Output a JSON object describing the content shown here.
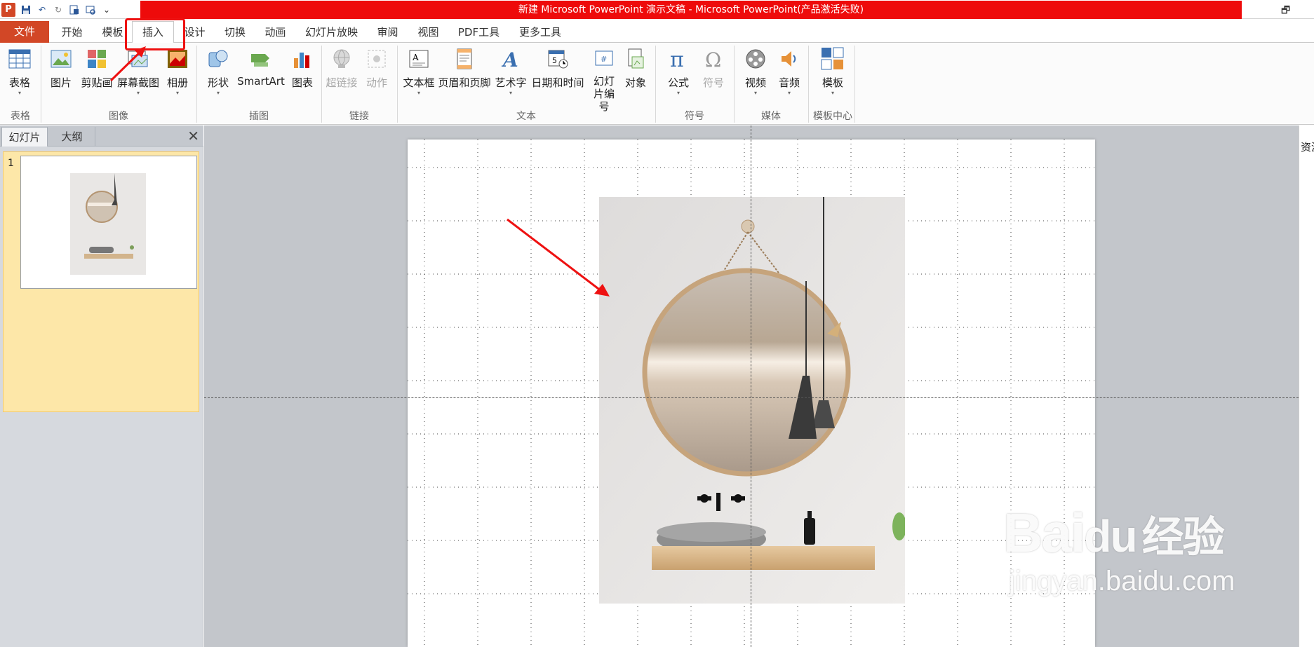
{
  "window": {
    "title": "新建 Microsoft PowerPoint 演示文稿 - Microsoft PowerPoint(产品激活失败)",
    "app_icon_letter": "P",
    "restore_glyph": "🗗"
  },
  "quick_access": {
    "icons": [
      "save-icon",
      "undo-icon",
      "redo-icon",
      "new-slide-icon",
      "print-preview-icon",
      "customize-icon"
    ]
  },
  "tabs": [
    {
      "label": "文件"
    },
    {
      "label": "开始"
    },
    {
      "label": "模板"
    },
    {
      "label": "插入"
    },
    {
      "label": "设计"
    },
    {
      "label": "切换"
    },
    {
      "label": "动画"
    },
    {
      "label": "幻灯片放映"
    },
    {
      "label": "审阅"
    },
    {
      "label": "视图"
    },
    {
      "label": "PDF工具"
    },
    {
      "label": "更多工具"
    }
  ],
  "active_tab": "插入",
  "ribbon": {
    "groups": [
      {
        "label": "表格"
      },
      {
        "label": "图像"
      },
      {
        "label": "插图"
      },
      {
        "label": "链接"
      },
      {
        "label": "文本"
      },
      {
        "label": "符号"
      },
      {
        "label": "媒体"
      },
      {
        "label": "模板中心"
      }
    ],
    "buttons": {
      "table": "表格",
      "picture": "图片",
      "clipart": "剪贴画",
      "screenshot": "屏幕截图",
      "album": "相册",
      "shapes": "形状",
      "smartart": "SmartArt",
      "chart": "图表",
      "hyperlink": "超链接",
      "action": "动作",
      "textbox": "文本框",
      "header_footer": "页眉和页脚",
      "wordart": "艺术字",
      "datetime": "日期和时间",
      "slide_number": "幻灯片编号",
      "object": "对象",
      "equation": "公式",
      "symbol": "符号",
      "video": "视频",
      "audio": "音频",
      "template": "模板"
    }
  },
  "slide_panel": {
    "tabs": [
      "幻灯片",
      "大纲"
    ],
    "close_glyph": "✕",
    "slides": [
      {
        "number": "1"
      }
    ]
  },
  "right_pane": {
    "label": "资源"
  },
  "watermark": {
    "brand": "Bai",
    "brand_cn": "经验",
    "url": "jingyan.baidu.com"
  },
  "colors": {
    "title_bar": "#ee0b0b",
    "file_tab": "#d24726",
    "annotation": "#ee1111"
  }
}
